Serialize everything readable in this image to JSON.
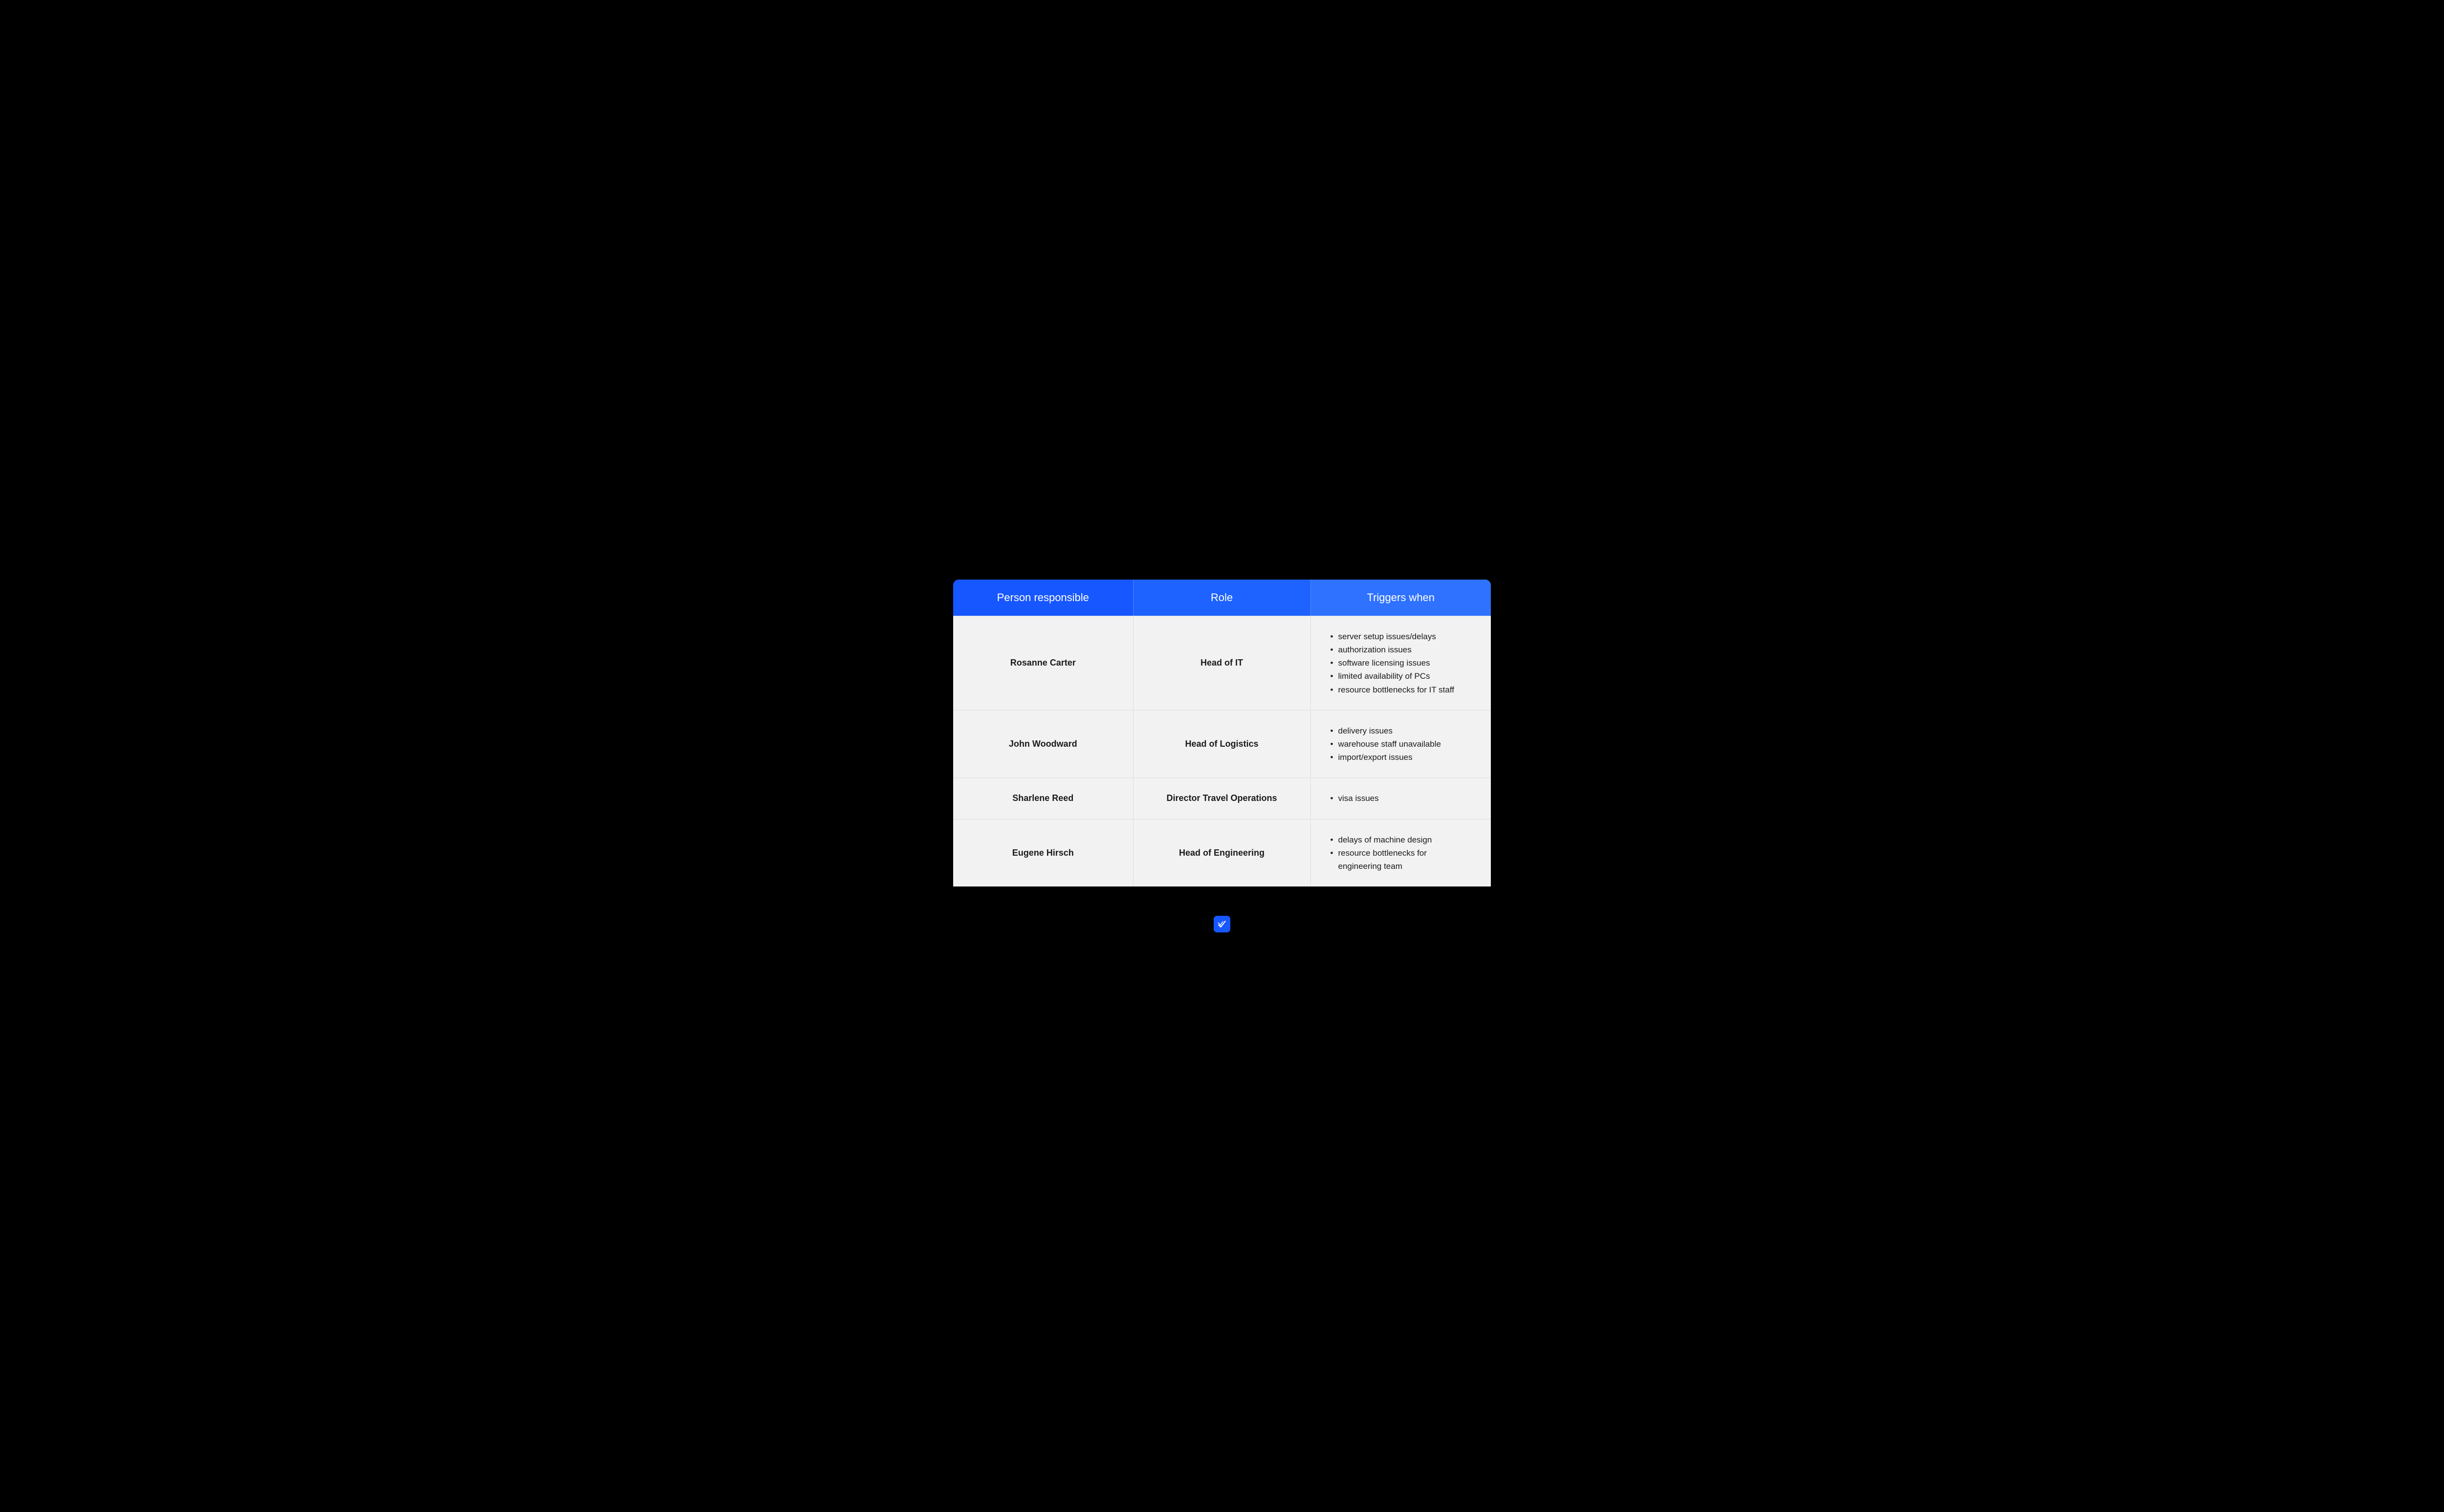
{
  "headers": {
    "person": "Person responsible",
    "role": "Role",
    "triggers": "Triggers when"
  },
  "rows": [
    {
      "person": "Rosanne Carter",
      "role": "Head of IT",
      "triggers": [
        "server setup issues/delays",
        "authorization issues",
        "software licensing issues",
        "limited availability of PCs",
        "resource bottlenecks for IT staff"
      ]
    },
    {
      "person": "John Woodward",
      "role": "Head of Logistics",
      "triggers": [
        "delivery issues",
        "warehouse staff unavailable",
        "import/export issues"
      ]
    },
    {
      "person": "Sharlene Reed",
      "role": "Director Travel Operations",
      "triggers": [
        "visa issues"
      ]
    },
    {
      "person": "Eugene Hirsch",
      "role": "Head of Engineering",
      "triggers": [
        "delays of machine design",
        "resource bottlenecks for engineering team"
      ]
    }
  ]
}
